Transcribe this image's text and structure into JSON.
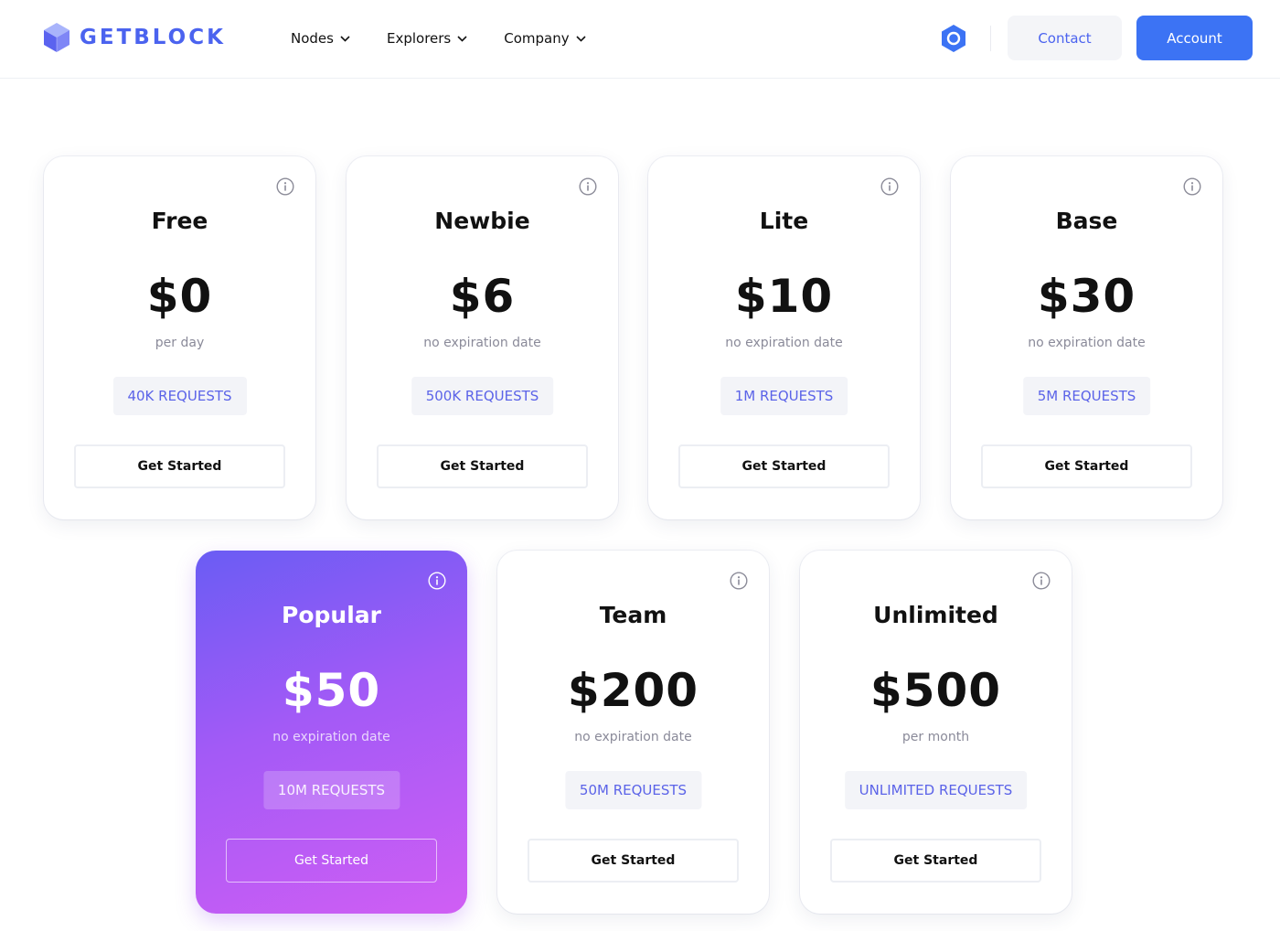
{
  "brand": {
    "name": "GETBLOCK",
    "color": "#4b63ef"
  },
  "nav": {
    "items": [
      {
        "label": "Nodes"
      },
      {
        "label": "Explorers"
      },
      {
        "label": "Company"
      }
    ]
  },
  "header": {
    "contact_label": "Contact",
    "account_label": "Account",
    "accent": "#3c73f4"
  },
  "plans": [
    {
      "name": "Free",
      "price": "$0",
      "period": "per day",
      "requests": "40K REQUESTS",
      "cta": "Get Started"
    },
    {
      "name": "Newbie",
      "price": "$6",
      "period": "no expiration date",
      "requests": "500K REQUESTS",
      "cta": "Get Started"
    },
    {
      "name": "Lite",
      "price": "$10",
      "period": "no expiration date",
      "requests": "1M REQUESTS",
      "cta": "Get Started"
    },
    {
      "name": "Base",
      "price": "$30",
      "period": "no expiration date",
      "requests": "5M REQUESTS",
      "cta": "Get Started"
    },
    {
      "name": "Popular",
      "price": "$50",
      "period": "no expiration date",
      "requests": "10M REQUESTS",
      "cta": "Get Started",
      "highlighted": true
    },
    {
      "name": "Team",
      "price": "$200",
      "period": "no expiration date",
      "requests": "50M REQUESTS",
      "cta": "Get Started"
    },
    {
      "name": "Unlimited",
      "price": "$500",
      "period": "per month",
      "requests": "UNLIMITED REQUESTS",
      "cta": "Get Started"
    }
  ],
  "icons": {
    "logo": "cube-logo-icon",
    "nav_chevron": "chevron-down-icon",
    "hex": "hexagon-icon",
    "info": "info-icon"
  }
}
